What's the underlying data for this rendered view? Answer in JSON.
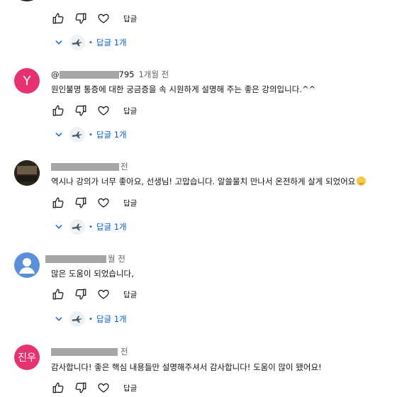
{
  "top": {
    "reply_label": "답글",
    "replies_label": "답글 1개"
  },
  "comments": [
    {
      "author_suffix": "795",
      "time": "1개월 전",
      "avatar_letter": "Y",
      "avatar_color": "#e6326e",
      "text": "원인불명 통증에 대한 궁금증을 속 시원하게 설명해 주는 좋은 강의입니다.^^",
      "reply_label": "답글",
      "replies_label": "답글 1개"
    },
    {
      "time": "전",
      "avatar_color": "#3a2f22",
      "text": "역시나 강의가 너무 좋아요, 선생님! 고맙습니다. 알쓸물치 만나서 온전하게 살게 되었어요",
      "reply_label": "답글",
      "replies_label": "답글 1개"
    },
    {
      "time": "월 전",
      "avatar_color": "#5b8fdb",
      "text": "많은 도움이 되었습니다,",
      "reply_label": "답글",
      "replies_label": "답글 1개"
    },
    {
      "time": "전",
      "avatar_text": "진우",
      "avatar_color": "#e6326e",
      "text": "감사합니다! 좋은 핵심 내용들만 설명해주셔서 감사합니다! 도움이 많이 됐어요!",
      "reply_label": "답글"
    }
  ]
}
